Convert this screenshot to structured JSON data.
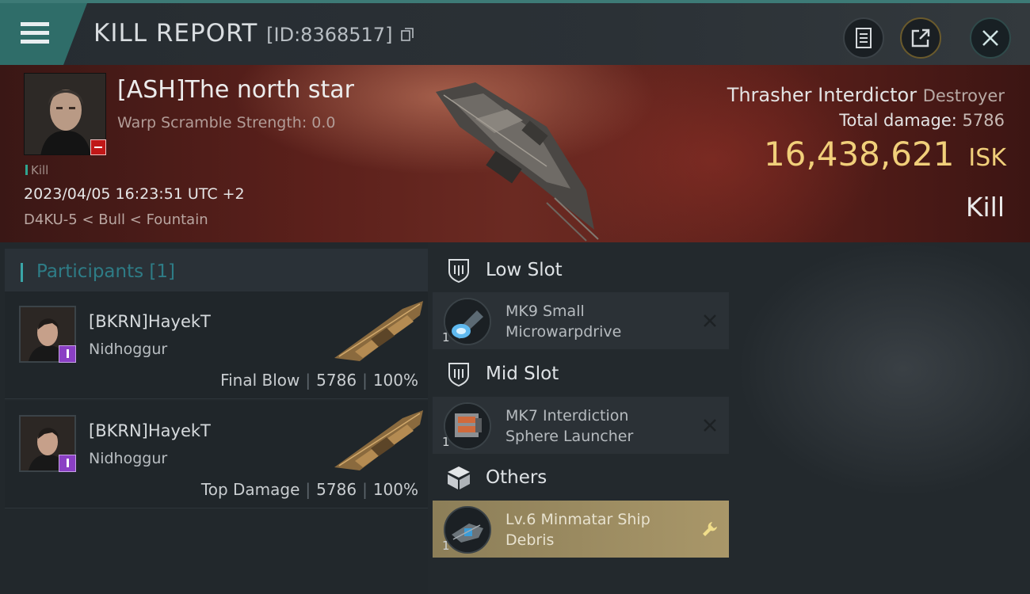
{
  "header": {
    "title": "KILL REPORT",
    "report_id": "[ID:8368517]"
  },
  "victim": {
    "name": "[ASH]The north star",
    "scramble": "Warp Scramble Strength: 0.0",
    "kill_tag": "Kill",
    "datetime": "2023/04/05 16:23:51 UTC +2",
    "location": "D4KU-5 < Bull < Fountain",
    "ship_name": "Thrasher Interdictor",
    "ship_class": "Destroyer",
    "total_damage_label": "Total damage:",
    "total_damage": "5786",
    "isk_value": "16,438,621",
    "isk_unit": "ISK",
    "result": "Kill"
  },
  "participants": {
    "label": "Participants",
    "count": "[1]",
    "rows": [
      {
        "name": "[BKRN]HayekT",
        "ship": "Nidhoggur",
        "role": "Final Blow",
        "damage": "5786",
        "percent": "100%"
      },
      {
        "name": "[BKRN]HayekT",
        "ship": "Nidhoggur",
        "role": "Top Damage",
        "damage": "5786",
        "percent": "100%"
      }
    ]
  },
  "slots": {
    "low": {
      "label": "Low Slot",
      "item": {
        "line1": "MK9 Small",
        "line2": "Microwarpdrive",
        "qty": "1"
      }
    },
    "mid": {
      "label": "Mid Slot",
      "item": {
        "line1": "MK7 Interdiction",
        "line2": "Sphere Launcher",
        "qty": "1"
      }
    },
    "others": {
      "label": "Others",
      "item": {
        "line1": "Lv.6 Minmatar Ship",
        "line2": "Debris",
        "qty": "1"
      }
    }
  },
  "icons": {
    "menu": "menu-icon",
    "copy": "copy-icon",
    "notes": "document-icon",
    "share": "share-icon",
    "close": "close-icon",
    "slot": "shield-slot-icon",
    "others": "cube-icon",
    "destroyed": "x-icon",
    "salvage": "wrench-icon"
  },
  "colors": {
    "accent_teal": "#3d7a76",
    "isk_gold": "#f1cf7a",
    "badge_red": "#c01818",
    "badge_purple": "#8a3fc4",
    "loot_gold": "#a99769"
  }
}
